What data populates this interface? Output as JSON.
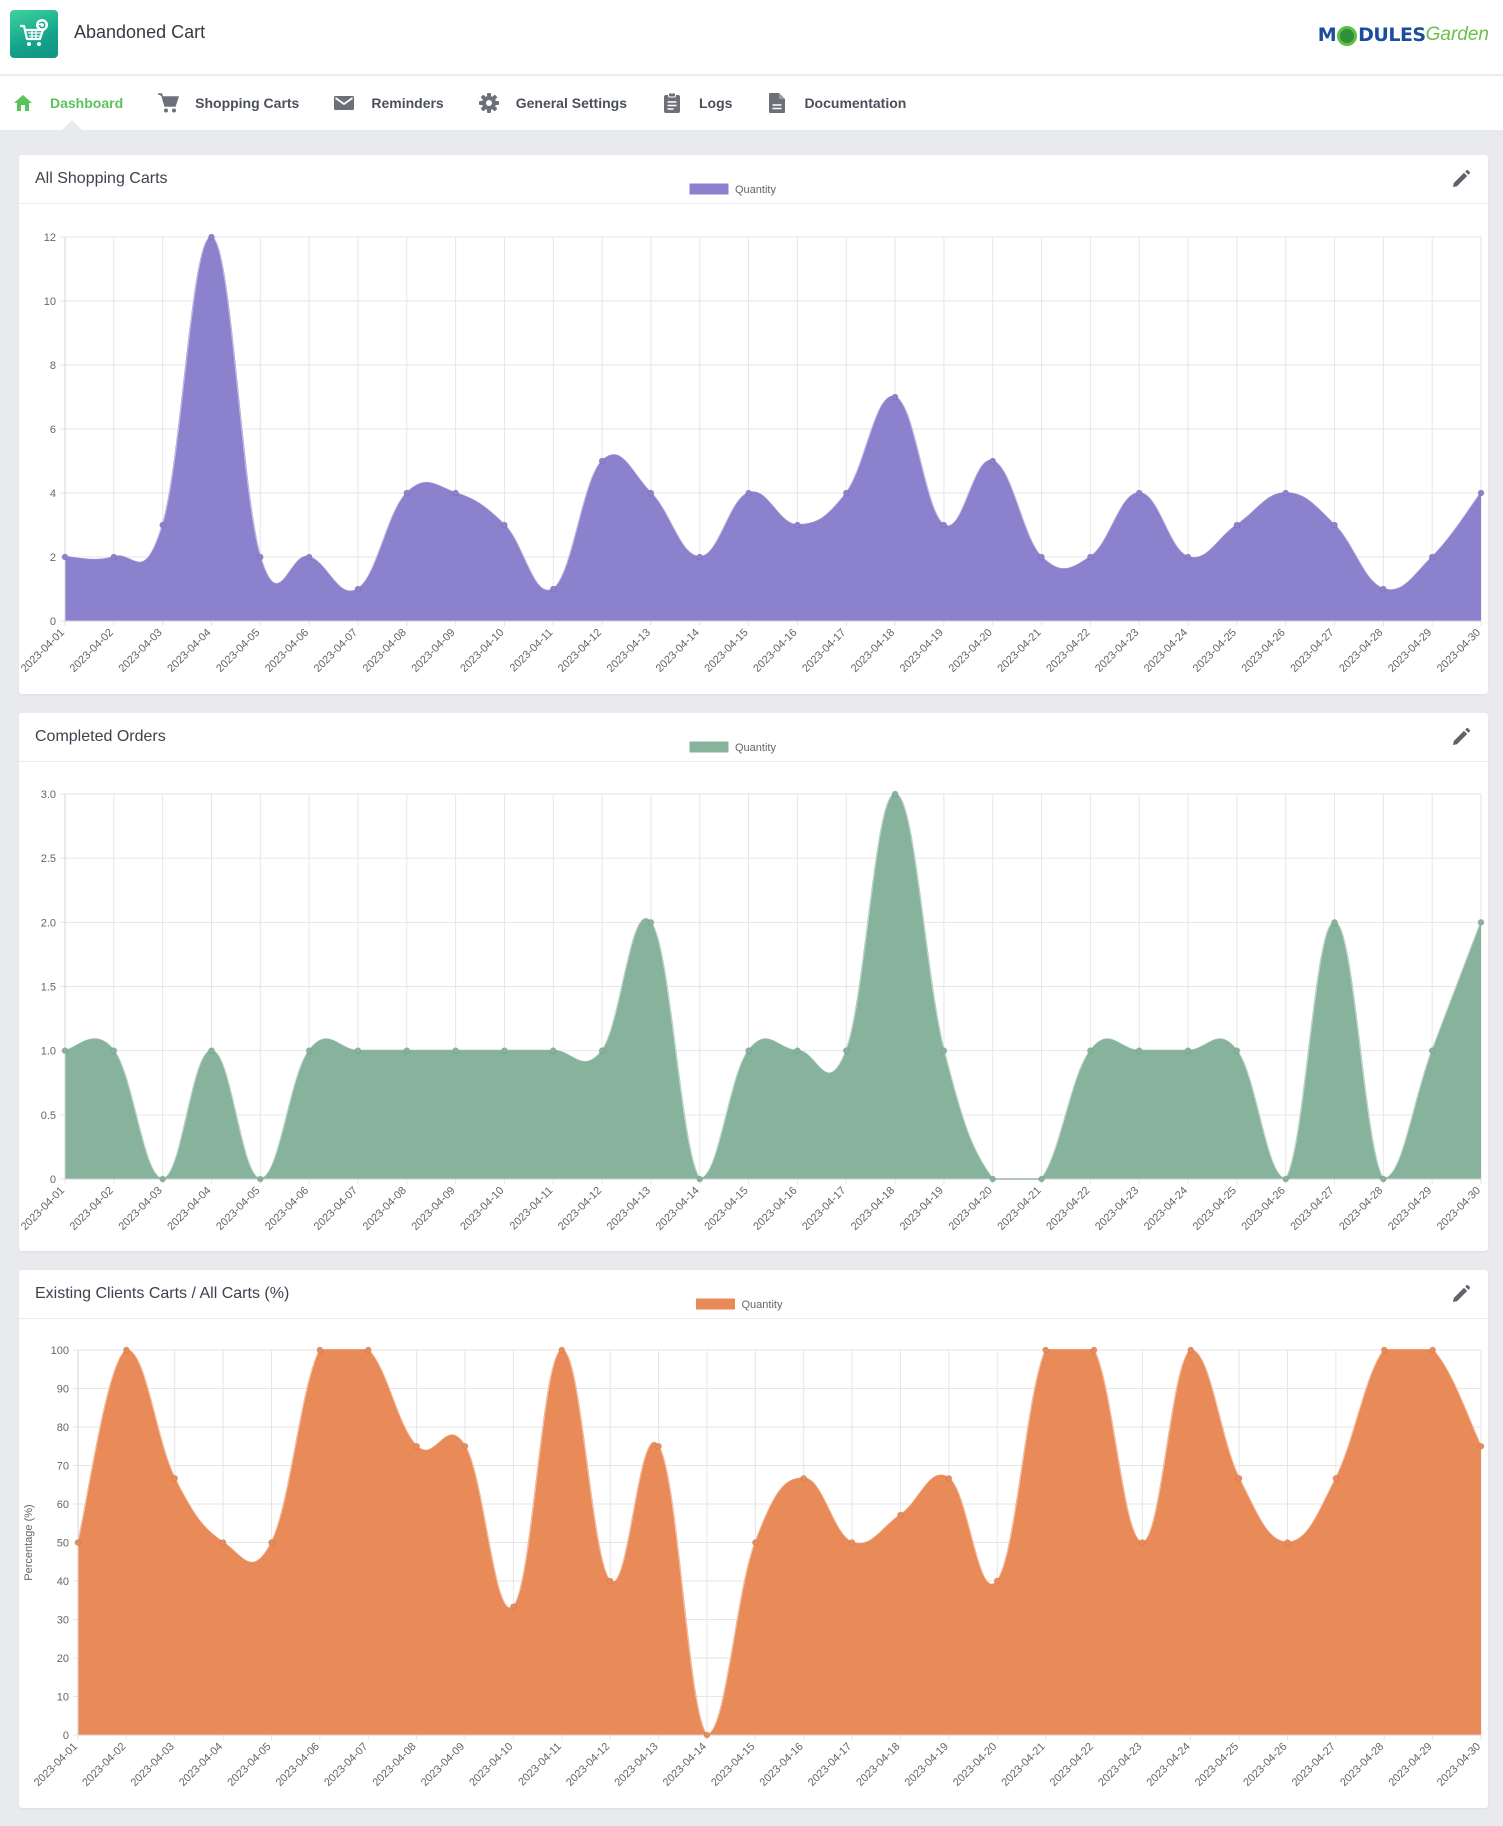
{
  "app": {
    "title": "Abandoned Cart",
    "logo_icon": "cart-refresh-icon",
    "brand": {
      "strong": "M",
      "strong2": "DULES",
      "light": "Garden"
    }
  },
  "nav": {
    "items": [
      {
        "label": "Dashboard",
        "icon": "home-icon",
        "active": true
      },
      {
        "label": "Shopping Carts",
        "icon": "cart-icon",
        "active": false
      },
      {
        "label": "Reminders",
        "icon": "envelope-icon",
        "active": false
      },
      {
        "label": "General Settings",
        "icon": "gear-icon",
        "active": false
      },
      {
        "label": "Logs",
        "icon": "clipboard-icon",
        "active": false
      },
      {
        "label": "Documentation",
        "icon": "document-icon",
        "active": false
      }
    ]
  },
  "colors": {
    "accent": "#5bc35b",
    "purple": "#8c81cc",
    "green": "#87b39c",
    "orange": "#e98b58"
  },
  "chart_data": [
    {
      "type": "area",
      "title": "All Shopping Carts",
      "legend": [
        "Quantity"
      ],
      "legend_position": "top",
      "xlabel": "",
      "ylabel": "",
      "x": [
        "2023-04-01",
        "2023-04-02",
        "2023-04-03",
        "2023-04-04",
        "2023-04-05",
        "2023-04-06",
        "2023-04-07",
        "2023-04-08",
        "2023-04-09",
        "2023-04-10",
        "2023-04-11",
        "2023-04-12",
        "2023-04-13",
        "2023-04-14",
        "2023-04-15",
        "2023-04-16",
        "2023-04-17",
        "2023-04-18",
        "2023-04-19",
        "2023-04-20",
        "2023-04-21",
        "2023-04-22",
        "2023-04-23",
        "2023-04-24",
        "2023-04-25",
        "2023-04-26",
        "2023-04-27",
        "2023-04-28",
        "2023-04-29",
        "2023-04-30"
      ],
      "series": [
        {
          "name": "Quantity",
          "color": "#8c81cc",
          "values": [
            2,
            2,
            3,
            12,
            2,
            2,
            1,
            4,
            4,
            3,
            1,
            5,
            4,
            2,
            4,
            3,
            4,
            7,
            3,
            5,
            2,
            2,
            4,
            2,
            3,
            4,
            3,
            1,
            2,
            4
          ]
        }
      ],
      "ylim": [
        0,
        12
      ],
      "yticks": [
        "0",
        "2",
        "4",
        "6",
        "8",
        "10",
        "12"
      ],
      "grid": true
    },
    {
      "type": "area",
      "title": "Completed Orders",
      "legend": [
        "Quantity"
      ],
      "legend_position": "top",
      "xlabel": "",
      "ylabel": "",
      "x": [
        "2023-04-01",
        "2023-04-02",
        "2023-04-03",
        "2023-04-04",
        "2023-04-05",
        "2023-04-06",
        "2023-04-07",
        "2023-04-08",
        "2023-04-09",
        "2023-04-10",
        "2023-04-11",
        "2023-04-12",
        "2023-04-13",
        "2023-04-14",
        "2023-04-15",
        "2023-04-16",
        "2023-04-17",
        "2023-04-18",
        "2023-04-19",
        "2023-04-20",
        "2023-04-21",
        "2023-04-22",
        "2023-04-23",
        "2023-04-24",
        "2023-04-25",
        "2023-04-26",
        "2023-04-27",
        "2023-04-28",
        "2023-04-29",
        "2023-04-30"
      ],
      "series": [
        {
          "name": "Quantity",
          "color": "#87b39c",
          "values": [
            1,
            1,
            0,
            1,
            0,
            1,
            1,
            1,
            1,
            1,
            1,
            1,
            2,
            0,
            1,
            1,
            1,
            3,
            1,
            0,
            0,
            1,
            1,
            1,
            1,
            0,
            2,
            0,
            1,
            2
          ]
        }
      ],
      "ylim": [
        0,
        3
      ],
      "yticks": [
        "0",
        "0.5",
        "1.0",
        "1.5",
        "2.0",
        "2.5",
        "3.0"
      ],
      "grid": true
    },
    {
      "type": "area",
      "title": "Existing Clients Carts / All Carts (%)",
      "legend": [
        "Quantity"
      ],
      "legend_position": "top",
      "xlabel": "",
      "ylabel": "Percentage (%)",
      "x": [
        "2023-04-01",
        "2023-04-02",
        "2023-04-03",
        "2023-04-04",
        "2023-04-05",
        "2023-04-06",
        "2023-04-07",
        "2023-04-08",
        "2023-04-09",
        "2023-04-10",
        "2023-04-11",
        "2023-04-12",
        "2023-04-13",
        "2023-04-14",
        "2023-04-15",
        "2023-04-16",
        "2023-04-17",
        "2023-04-18",
        "2023-04-19",
        "2023-04-20",
        "2023-04-21",
        "2023-04-22",
        "2023-04-23",
        "2023-04-24",
        "2023-04-25",
        "2023-04-26",
        "2023-04-27",
        "2023-04-28",
        "2023-04-29",
        "2023-04-30"
      ],
      "series": [
        {
          "name": "Quantity",
          "color": "#e98b58",
          "values": [
            50,
            100,
            66.67,
            50,
            50,
            100,
            100,
            75,
            75,
            33.33,
            100,
            40,
            75,
            0,
            50,
            66.67,
            50,
            57.14,
            66.67,
            40,
            100,
            100,
            50,
            100,
            66.67,
            50,
            66.67,
            100,
            100,
            75
          ]
        }
      ],
      "ylim": [
        0,
        100
      ],
      "yticks": [
        "0",
        "10",
        "20",
        "30",
        "40",
        "50",
        "60",
        "70",
        "80",
        "90",
        "100"
      ],
      "grid": true
    }
  ]
}
